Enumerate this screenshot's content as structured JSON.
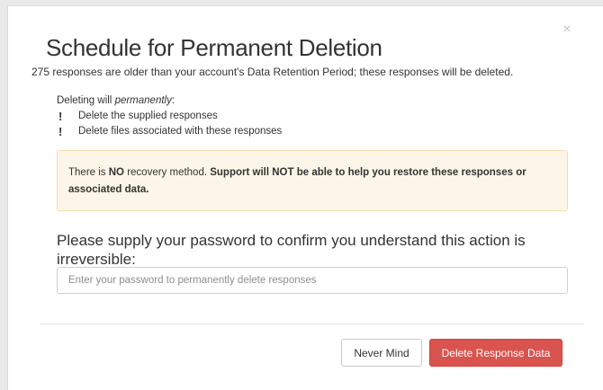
{
  "dialog": {
    "title": "Schedule for Permanent Deletion",
    "subtitle": "275 responses are older than your account's Data Retention Period; these responses will be deleted.",
    "close_symbol": "×",
    "deleting_prefix": "Deleting will ",
    "deleting_emphasis": "permanently",
    "deleting_suffix": ":",
    "bullet_symbol": "!",
    "bullets": [
      "Delete the supplied responses",
      "Delete files associated with these responses"
    ],
    "warning": {
      "part1": "There is ",
      "part2_bold": "NO",
      "part3": " recovery method. ",
      "part4_bold": "Support will NOT be able to help you restore these responses or associated data."
    },
    "password_label": "Please supply your password to confirm you understand this action is irreversible:",
    "password_placeholder": "Enter your password to permanently delete responses",
    "password_value": "",
    "buttons": {
      "cancel": "Never Mind",
      "delete": "Delete Response Data"
    }
  },
  "colors": {
    "danger": "#d9534f",
    "warning_bg": "#fcf6e8",
    "warning_border": "#f4ddb0"
  }
}
